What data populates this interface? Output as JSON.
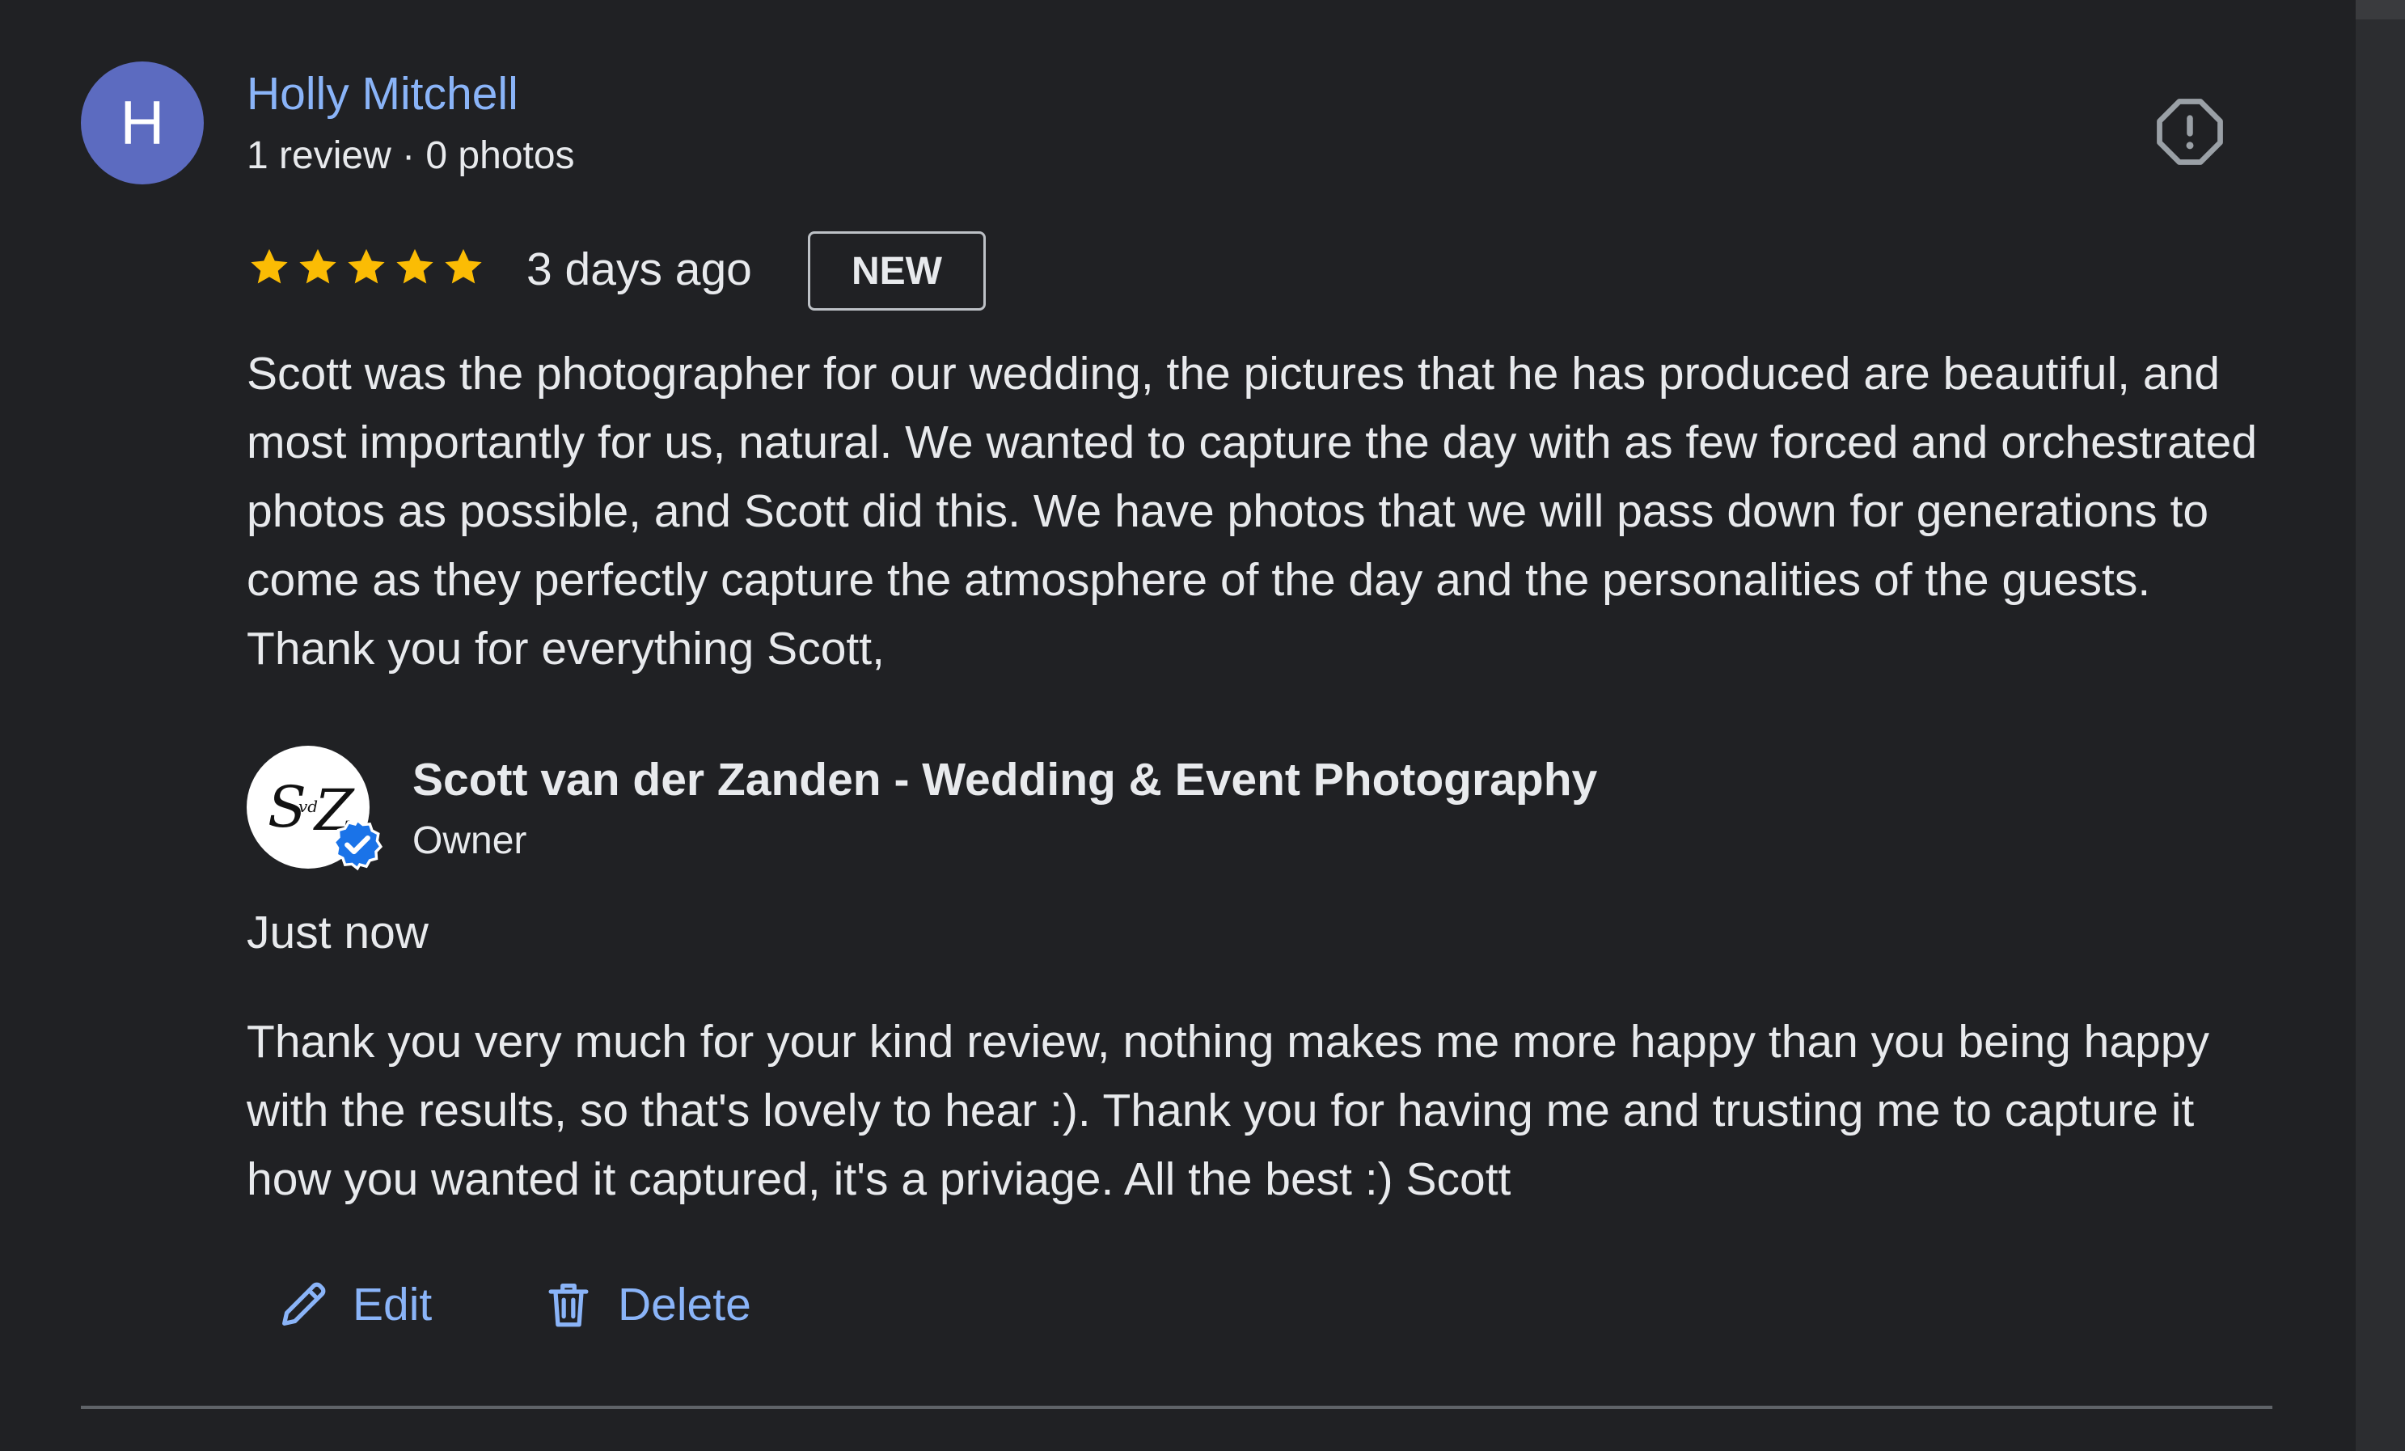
{
  "reviewer": {
    "avatar_letter": "H",
    "name": "Holly Mitchell",
    "meta": "1 review · 0 photos"
  },
  "review": {
    "rating": 5,
    "max_rating": 5,
    "time": "3 days ago",
    "badge": "NEW",
    "text": "Scott was the photographer for our wedding, the pictures that he has produced are beautiful, and most importantly for us, natural. We wanted to capture the day with as few forced and orchestrated photos as possible, and Scott did this. We have photos that we will pass down for generations to come as they perfectly capture the atmosphere of the day and the personalities of the guests. Thank you for everything Scott,"
  },
  "owner_reply": {
    "name": "Scott van der Zanden - Wedding & Event Photography",
    "role": "Owner",
    "logo_text": "SvdZ",
    "time": "Just now",
    "text": "Thank you very much for your kind review, nothing makes me more happy than you being happy with the results, so that's lovely to hear :). Thank you for having me and trusting me to capture it how you wanted it captured, it's a priviage. All the best :) Scott"
  },
  "actions": {
    "edit_label": "Edit",
    "delete_label": "Delete"
  },
  "icons": {
    "report": "report-flag-icon",
    "star": "star-icon",
    "verified": "verified-badge-icon",
    "edit": "pencil-icon",
    "delete": "trash-icon"
  },
  "colors": {
    "background": "#202124",
    "link": "#8ab4f8",
    "text": "#e8eaed",
    "star": "#fbbc04",
    "avatar": "#5c6bc0",
    "verified": "#1a73e8"
  }
}
